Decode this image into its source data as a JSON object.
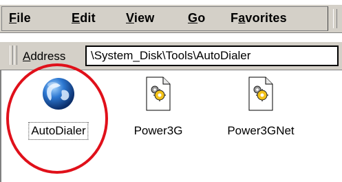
{
  "menubar": {
    "items": [
      {
        "label": "File",
        "underline": "F",
        "rest": "ile"
      },
      {
        "label": "Edit",
        "underline": "E",
        "rest": "dit"
      },
      {
        "label": "View",
        "underline": "V",
        "rest": "iew"
      },
      {
        "label": "Go",
        "underline": "G",
        "rest": "o"
      },
      {
        "label": "Favorites",
        "prefix": "F",
        "underline": "a",
        "rest": "vorites"
      }
    ]
  },
  "address": {
    "label_underline": "A",
    "label_rest": "ddress",
    "value": "\\System_Disk\\Tools\\AutoDialer"
  },
  "files": [
    {
      "label": "AutoDialer",
      "icon": "globe-icon",
      "selected": true
    },
    {
      "label": "Power3G",
      "icon": "gear-document-icon",
      "selected": false
    },
    {
      "label": "Power3GNet",
      "icon": "gear-document-icon",
      "selected": false
    }
  ],
  "colors": {
    "toolbar_bg": "#d4d0c8",
    "highlight_ring": "#e0101a",
    "gear_yellow": "#f2c21a"
  }
}
